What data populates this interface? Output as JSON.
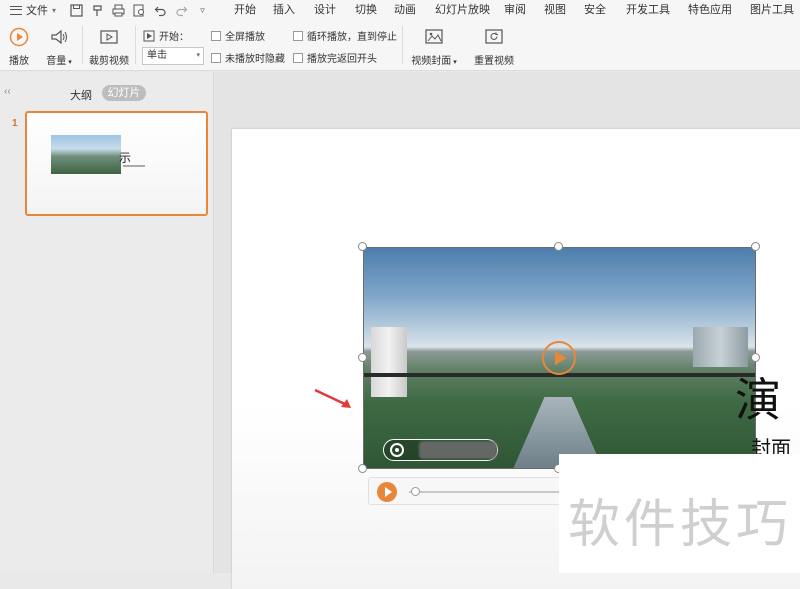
{
  "menubar": {
    "file_label": "文件",
    "quick_access": [
      "save-icon",
      "format-painter-icon",
      "print-icon",
      "print-preview-icon",
      "undo-icon",
      "redo-icon",
      "customize-icon"
    ],
    "tabs": [
      "开始",
      "插入",
      "设计",
      "切换",
      "动画",
      "幻灯片放映",
      "审阅",
      "视图",
      "安全",
      "开发工具",
      "特色应用",
      "图片工具"
    ]
  },
  "ribbon": {
    "play_label": "播放",
    "volume_label": "音量",
    "trim_label": "裁剪视频",
    "start_label": "开始：",
    "start_value": "单击",
    "fullscreen_label": "全屏播放",
    "hide_when_not_playing_label": "未播放时隐藏",
    "loop_label": "循环播放，直到停止",
    "rewind_label": "播放完返回开头",
    "video_cover_label": "视频封面",
    "reset_video_label": "重置视频"
  },
  "left_panel": {
    "outline_tab": "大纲",
    "slides_tab": "幻灯片",
    "slide_number": "1",
    "thumb_title": "示"
  },
  "slide": {
    "title_fragment": "演",
    "subtitle_fragment": "封面",
    "watermark": "软件技巧"
  },
  "colors": {
    "accent": "#e8873a",
    "arrow": "#e03a3a"
  }
}
